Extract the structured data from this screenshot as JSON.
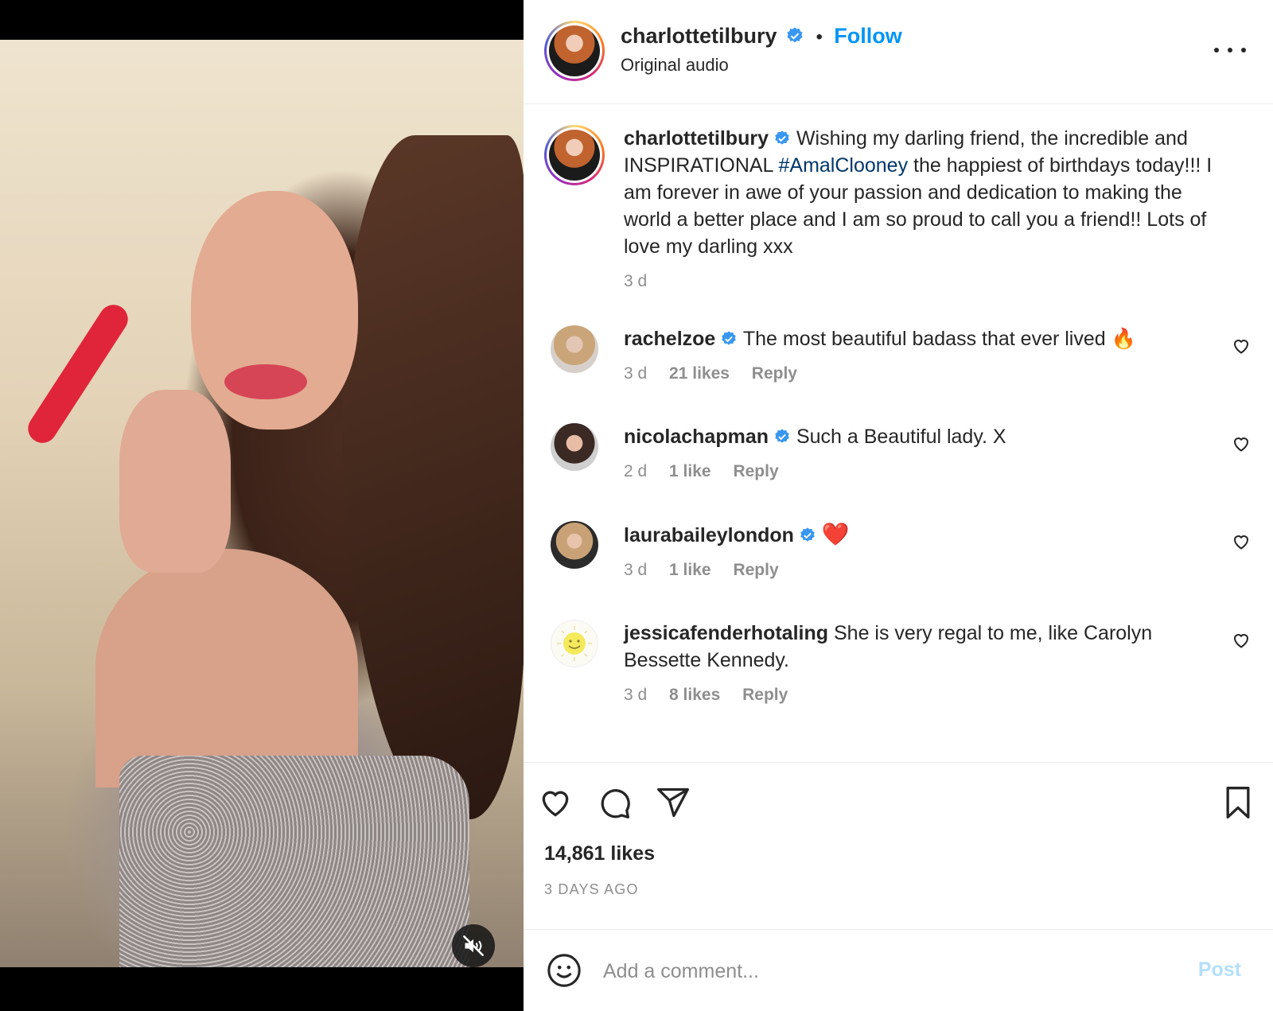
{
  "colors": {
    "accent": "#0095f6",
    "hashtag": "#00376b",
    "muted": "#8e8e8e",
    "verified": "#3897f0",
    "post_disabled": "#b2dffc"
  },
  "header": {
    "username": "charlottetilbury",
    "separator": "•",
    "follow_label": "Follow",
    "subtitle": "Original audio"
  },
  "caption": {
    "username": "charlottetilbury",
    "text_before": "Wishing my darling friend, the incredible and INSPIRATIONAL ",
    "hashtag": "#AmalClooney",
    "text_after": " the happiest of birthdays today!!! I am forever in awe of your passion and dedication to making the world a better place and I am so proud to call you a friend!! Lots of love my darling xxx",
    "time": "3 d"
  },
  "comments": [
    {
      "username": "rachelzoe",
      "text": "The most beautiful badass that ever lived 🔥",
      "time": "3 d",
      "likes": "21 likes",
      "reply": "Reply"
    },
    {
      "username": "nicolachapman",
      "text": "Such a Beautiful lady. X",
      "time": "2 d",
      "likes": "1 like",
      "reply": "Reply"
    },
    {
      "username": "laurabaileylondon",
      "text": "❤️",
      "time": "3 d",
      "likes": "1 like",
      "reply": "Reply"
    },
    {
      "username": "jessicafenderhotaling",
      "text": "She is very regal to me, like Carolyn Bessette Kennedy.",
      "time": "3 d",
      "likes": "8 likes",
      "reply": "Reply"
    }
  ],
  "actions": {
    "likes_count": "14,861 likes",
    "posted_ago": "3 DAYS AGO",
    "icons": [
      "heart-icon",
      "comment-icon",
      "share-icon",
      "bookmark-icon"
    ]
  },
  "add_comment": {
    "placeholder": "Add a comment...",
    "post_label": "Post"
  }
}
